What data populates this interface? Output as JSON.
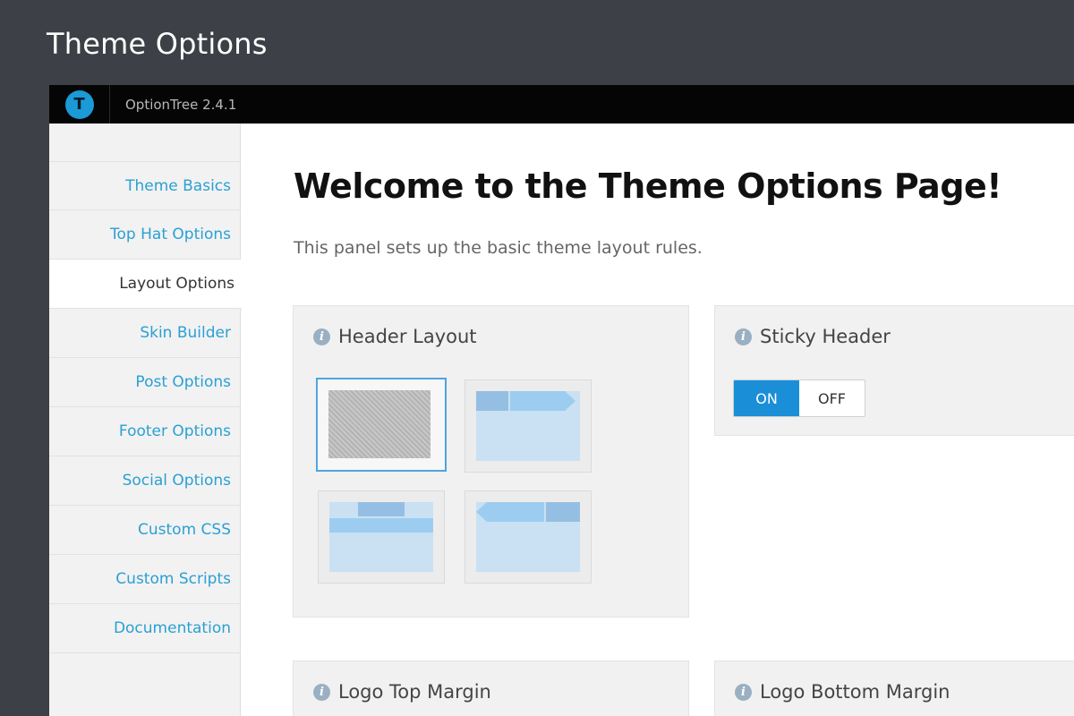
{
  "page": {
    "title": "Theme Options"
  },
  "topbar": {
    "logo_letter": "T",
    "version": "OptionTree 2.4.1"
  },
  "sidebar": {
    "items": [
      {
        "label": "Theme Basics"
      },
      {
        "label": "Top Hat Options"
      },
      {
        "label": "Layout Options",
        "active": true
      },
      {
        "label": "Skin Builder"
      },
      {
        "label": "Post Options"
      },
      {
        "label": "Footer Options"
      },
      {
        "label": "Social Options"
      },
      {
        "label": "Custom CSS"
      },
      {
        "label": "Custom Scripts"
      },
      {
        "label": "Documentation"
      }
    ]
  },
  "main": {
    "heading": "Welcome to the Theme Options Page!",
    "intro": "This panel sets up the basic theme layout rules."
  },
  "cards": {
    "header_layout": {
      "title": "Header Layout",
      "options": [
        "option-1",
        "option-2",
        "option-3",
        "option-4"
      ],
      "selected_index": 0
    },
    "sticky_header": {
      "title": "Sticky Header",
      "on_label": "ON",
      "off_label": "OFF",
      "value": "ON"
    },
    "logo_top_margin": {
      "title": "Logo Top Margin"
    },
    "logo_bottom_margin": {
      "title": "Logo Bottom Margin"
    }
  },
  "colors": {
    "accent": "#1a8fd8",
    "link": "#2aa0d3",
    "active_marker": "#7ad03a",
    "topbar": "#050505",
    "chrome": "#3d4046"
  },
  "icons": {
    "info": "info-icon",
    "logo": "optiontree-logo-icon"
  }
}
